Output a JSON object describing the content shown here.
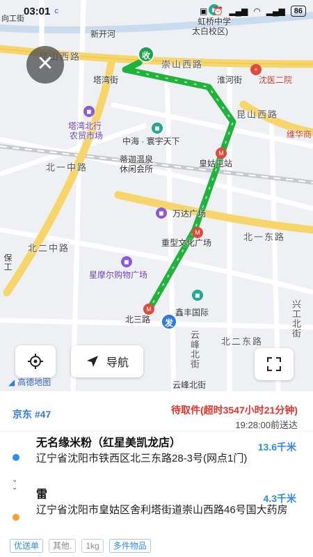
{
  "status_bar": {
    "left_label": "向工街",
    "time": "03:01",
    "carrier_icon": "c",
    "battery": "86"
  },
  "map": {
    "labels": {
      "xinkaihe": "新开河",
      "kunshan_xilu_top": "昆山西路",
      "tawan_jie": "塔湾街",
      "chongshan_xilu": "崇山西路",
      "huaihe_jie": "淮河街",
      "shenyi_eryuan": "沈医二院",
      "hongqiao_school": "虹桥中学",
      "hongqiao_school2": "太白校区)",
      "tawan_market": "塔湾北行",
      "tawan_market2": "农贸市场",
      "zhonghai": "中海 · 寰宇天下",
      "kunshan_xilu_right": "昆山西路",
      "weisheng": "维华商",
      "huanggutun": "皇姑屯站",
      "dijia_spa": "蒂迦温泉",
      "dijia_spa2": "休闲会所",
      "beiyi_zhonglu": "北一中路",
      "wanda": "万达广场",
      "beiyi_donglu": "北一东路",
      "zhongxing_square": "重型文化广场",
      "beier_zhonglu": "北二中路",
      "baoshan": "保工",
      "xingmoer": "星摩尔购物广场",
      "xinfeng": "鑫丰国际",
      "xingongbei": "兴工北街",
      "beisan": "北三路",
      "yunfeng_bei": "云峰北街",
      "beier_donglu": "北二东路",
      "yunfeng_beijie": "云峰北街",
      "amap": "高德地图"
    },
    "marker_pickup": "收",
    "marker_deliver": "发",
    "nav_label": "导航",
    "colors": {
      "route": "#20b23a",
      "road_yellow": "#f6d66a",
      "road_white": "#ffffff",
      "accent": "#2f7ae5"
    }
  },
  "order": {
    "number": "京东 #47",
    "status": "待取件(超时3547小时21分钟)",
    "deadline": "19:28:00前送达",
    "pickup": {
      "name": "无名缘米粉（红星美凯龙店）",
      "distance": "13.6千米",
      "address": "辽宁省沈阳市铁西区北三东路28-3号(网点1门)"
    },
    "dropoff": {
      "name": "雷",
      "distance": "4.3千米",
      "address": "辽宁省沈阳市皇姑区舍利塔街道崇山西路46号国大药房"
    },
    "tags": [
      "优送单",
      "其他.",
      "1kg",
      "多件物品"
    ]
  }
}
